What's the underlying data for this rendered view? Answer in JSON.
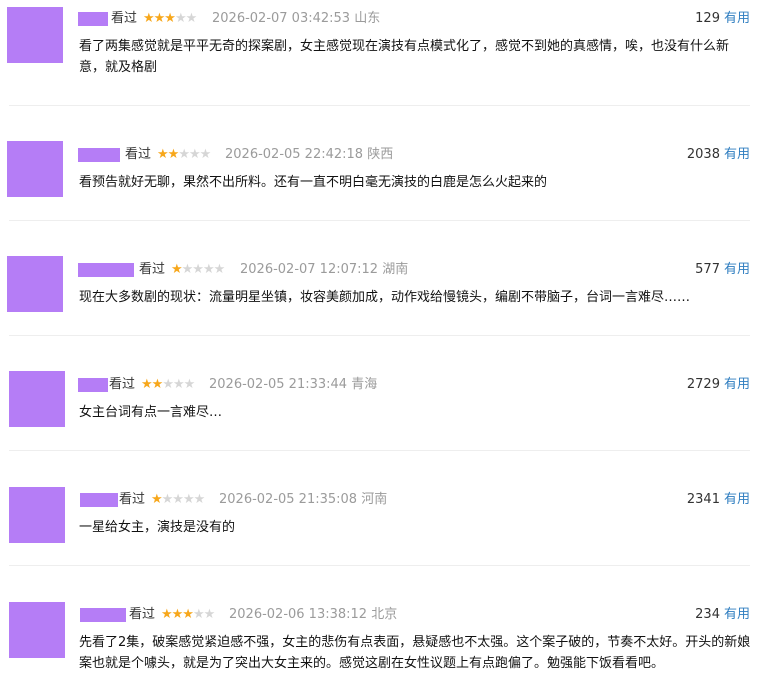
{
  "reviews": [
    {
      "watched_label": "看过",
      "stars": 3,
      "date": "2026-02-07 03:42:53",
      "location": "山东",
      "votes": "129",
      "useful_label": "有用",
      "text": "看了两集感觉就是平平无奇的探案剧，女主感觉现在演技有点模式化了，感觉不到她的真感情，唉，也没有什么新意，就及格剧"
    },
    {
      "watched_label": "看过",
      "stars": 2,
      "date": "2026-02-05 22:42:18",
      "location": "陕西",
      "votes": "2038",
      "useful_label": "有用",
      "text": "看预告就好无聊，果然不出所料。还有一直不明白毫无演技的白鹿是怎么火起来的"
    },
    {
      "watched_label": "看过",
      "stars": 1,
      "date": "2026-02-07 12:07:12",
      "location": "湖南",
      "votes": "577",
      "useful_label": "有用",
      "text": "现在大多数剧的现状：流量明星坐镇，妆容美颜加成，动作戏给慢镜头，编剧不带脑子，台词一言难尽……"
    },
    {
      "watched_label": "看过",
      "stars": 2,
      "date": "2026-02-05 21:33:44",
      "location": "青海",
      "votes": "2729",
      "useful_label": "有用",
      "text": "女主台词有点一言难尽…"
    },
    {
      "watched_label": "看过",
      "stars": 1,
      "date": "2026-02-05 21:35:08",
      "location": "河南",
      "votes": "2341",
      "useful_label": "有用",
      "text": "一星给女主，演技是没有的"
    },
    {
      "watched_label": "看过",
      "stars": 3,
      "date": "2026-02-06 13:38:12",
      "location": "北京",
      "votes": "234",
      "useful_label": "有用",
      "text": "先看了2集，破案感觉紧迫感不强，女主的悲伤有点表面，悬疑感也不太强。这个案子破的，节奏不太好。开头的新娘案也就是个噱头，就是为了突出大女主来的。感觉这剧在女性议题上有点跑偏了。勉强能下饭看看吧。"
    }
  ]
}
